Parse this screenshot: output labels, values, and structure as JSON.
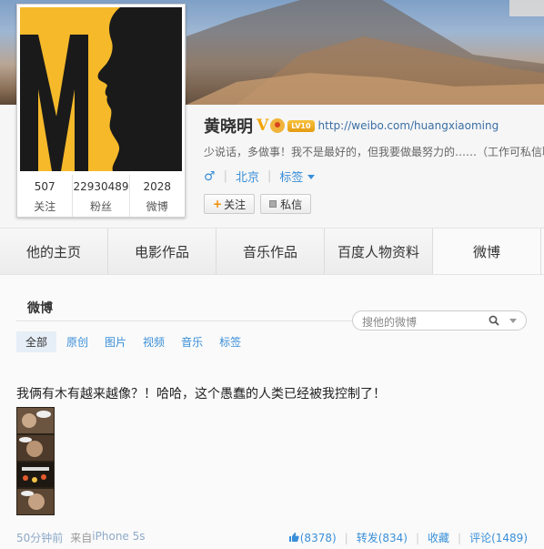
{
  "profile": {
    "name": "黄晓明",
    "verified_mark": "V",
    "level_badge": "LV10",
    "homepage": "http://weibo.com/huangxiaoming",
    "intro": "少说话，多做事！我不是最好的，但我要做最努力的……（工作可私信联",
    "gender_symbol": "♂",
    "city": "北京",
    "tags_label": "标签",
    "stats": [
      {
        "num": "507",
        "label": "关注"
      },
      {
        "num": "22930489",
        "label": "粉丝"
      },
      {
        "num": "2028",
        "label": "微博"
      }
    ],
    "follow_plus": "+",
    "follow_label": "关注",
    "message_label": "私信"
  },
  "tabs": [
    {
      "label": "他的主页"
    },
    {
      "label": "电影作品"
    },
    {
      "label": "音乐作品"
    },
    {
      "label": "百度人物资料"
    },
    {
      "label": "微博"
    }
  ],
  "feed": {
    "title": "微博",
    "search_placeholder": "搜他的微博",
    "filters": [
      "全部",
      "原创",
      "图片",
      "视频",
      "音乐",
      "标签"
    ],
    "post": {
      "text": "我俩有木有越来越像？！哈哈，这个愚蠢的人类已经被我控制了！",
      "time": "50分钟前",
      "from_label": "来自",
      "device": "iPhone 5s",
      "likes": "(8378)",
      "repost": "转发(834)",
      "favorite": "收藏",
      "comment": "评论(1489)"
    }
  },
  "colors": {
    "link": "#3a8fd8",
    "avatar_bg": "#f5b92a",
    "verified": "#f2a400"
  }
}
